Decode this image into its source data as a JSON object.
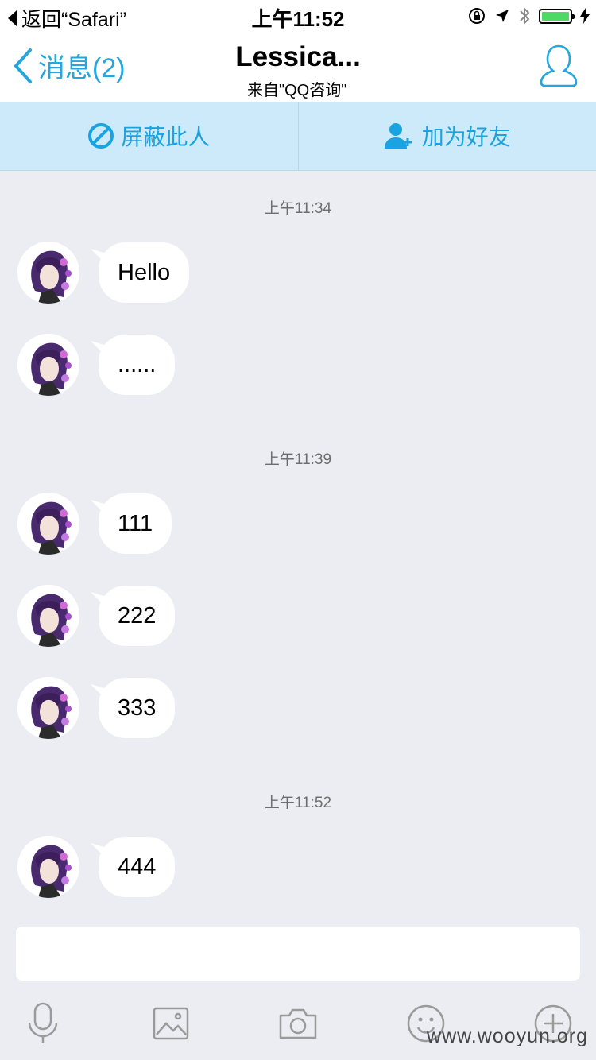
{
  "status_bar": {
    "back_app": "返回“Safari”",
    "time": "上午11:52"
  },
  "nav": {
    "back_label": "消息(2)",
    "title": "Lessica...",
    "subtitle": "来自\"QQ咨询\""
  },
  "actions": {
    "block_label": "屏蔽此人",
    "add_friend_label": "加为好友"
  },
  "timestamps": [
    "上午11:34",
    "上午11:39",
    "上午11:52"
  ],
  "messages": [
    "Hello",
    "......",
    "111",
    "222",
    "333",
    "444"
  ],
  "input": {
    "value": ""
  },
  "toolbar": {
    "icons": [
      "microphone-icon",
      "image-icon",
      "camera-icon",
      "emoji-icon",
      "plus-icon"
    ]
  },
  "watermark": "www.wooyun.org",
  "colors": {
    "accent": "#25a6dc",
    "action_bar_bg": "#cdeafb",
    "chat_bg": "#ebedf2",
    "battery": "#4cd964"
  }
}
